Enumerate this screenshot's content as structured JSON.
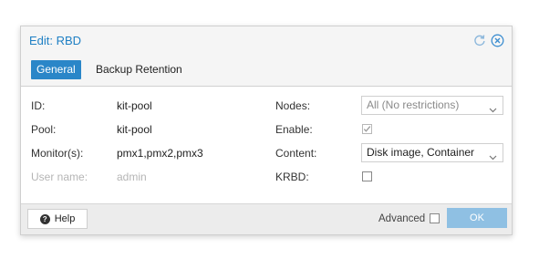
{
  "dialog": {
    "title": "Edit: RBD",
    "tools": [
      "reset-icon",
      "close-icon"
    ]
  },
  "tabs": [
    {
      "label": "General",
      "active": true
    },
    {
      "label": "Backup Retention",
      "active": false
    }
  ],
  "form": {
    "left": [
      {
        "label": "ID:",
        "value": "kit-pool"
      },
      {
        "label": "Pool:",
        "value": "kit-pool"
      },
      {
        "label": "Monitor(s):",
        "value": "pmx1,pmx2,pmx3"
      },
      {
        "label": "User name:",
        "value": "admin",
        "disabled": true
      }
    ],
    "nodes": {
      "label": "Nodes:",
      "placeholder": "All (No restrictions)"
    },
    "enable": {
      "label": "Enable:",
      "checked": true
    },
    "content": {
      "label": "Content:",
      "value": "Disk image, Container"
    },
    "krbd": {
      "label": "KRBD:",
      "checked": false
    }
  },
  "footer": {
    "help_label": "Help",
    "advanced_label": "Advanced",
    "advanced_checked": false,
    "ok_label": "OK"
  },
  "colors": {
    "accent": "#2a86c8",
    "title": "#1e7fc4",
    "ok_disabled": "#8fc0e3"
  }
}
